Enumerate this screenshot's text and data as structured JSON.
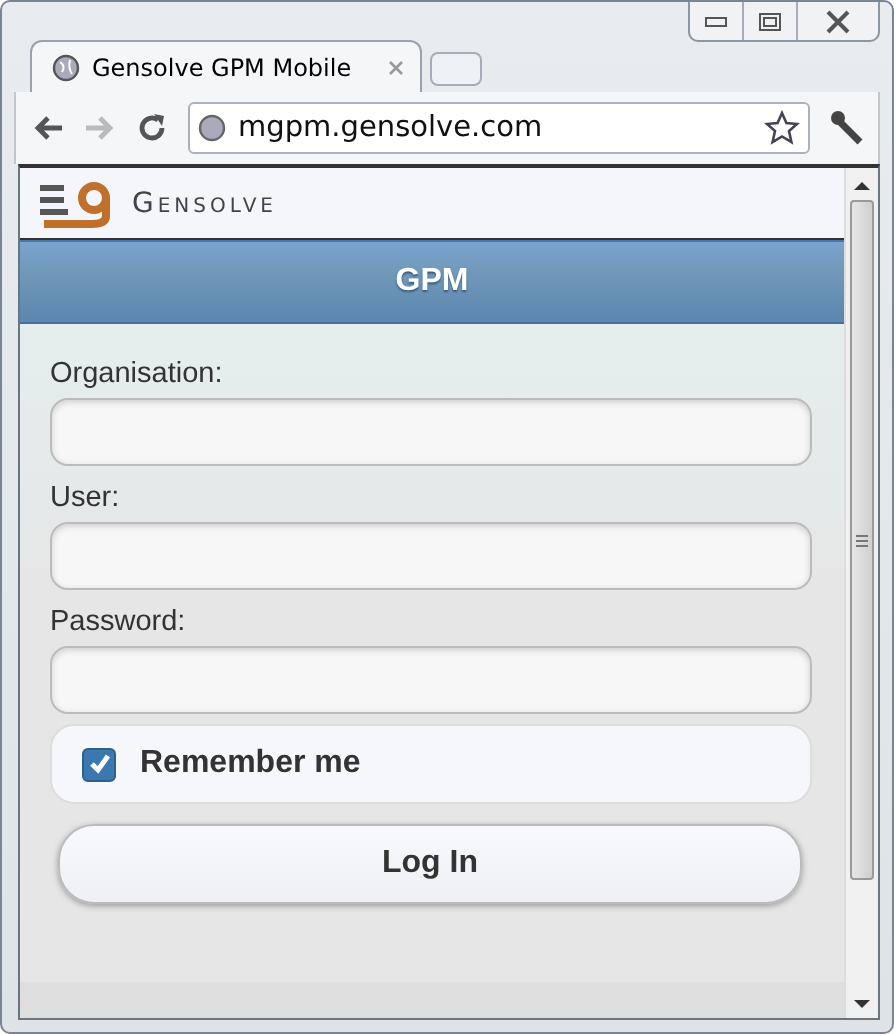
{
  "browser": {
    "tab_title": "Gensolve GPM Mobile",
    "url": "mgpm.gensolve.com"
  },
  "page": {
    "logo_text": "Gensolve",
    "header_title": "GPM",
    "fields": [
      {
        "label": "Organisation:"
      },
      {
        "label": "User:"
      },
      {
        "label": "Password:"
      }
    ],
    "remember": {
      "label": "Remember me",
      "checked": true
    },
    "button": "Log In"
  }
}
